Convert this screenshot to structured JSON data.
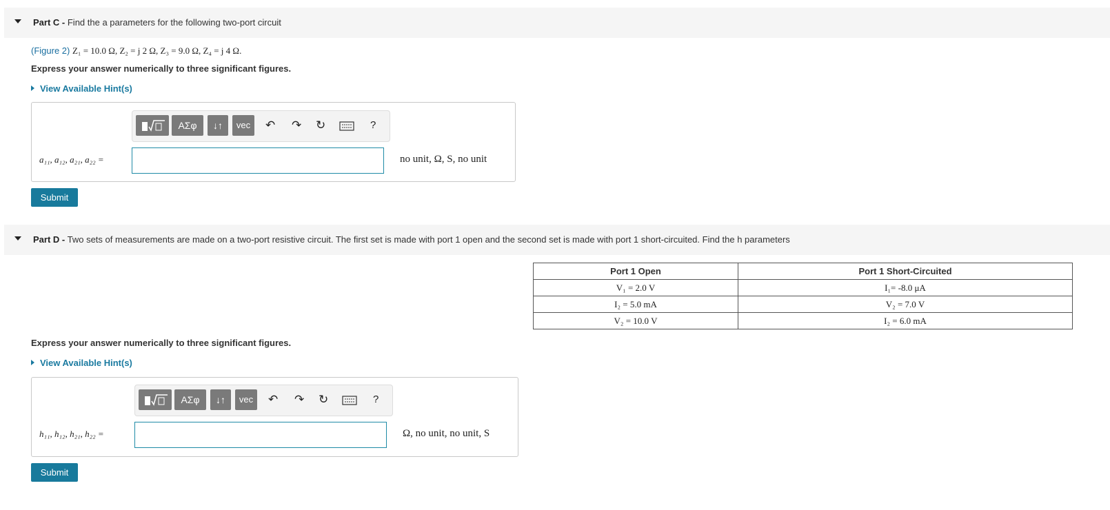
{
  "part_c": {
    "label": "Part C -",
    "title": "Find the a parameters for the following two-port circuit",
    "figure_link": "(Figure 2)",
    "givens": "Z₁ = 10.0 Ω, Z₂ = j 2 Ω, Z₃ = 9.0 Ω, Z₄ = j 4 Ω.",
    "instruction": "Express your answer numerically to three significant figures.",
    "hint": "View Available Hint(s)",
    "var_label": "a₁₁, a₁₂, a₂₁, a₂₂ =",
    "units": "no unit, Ω, S, no unit",
    "answer_value": "",
    "submit": "Submit"
  },
  "part_d": {
    "label": "Part D -",
    "title": "Two sets of measurements are made on a two-port resistive circuit.  The first set is made with port 1 open and the second set is made with port 1 short-circuited. Find the h parameters",
    "table": {
      "headers": [
        "Port 1 Open",
        "Port 1 Short-Circuited"
      ],
      "rows": [
        [
          "V₁ = 2.0  V",
          "I₁= -8.0 μA"
        ],
        [
          "I₂ = 5.0  mA",
          "V₂ = 7.0  V"
        ],
        [
          "V₂ = 10.0  V",
          "I₂ = 6.0  mA"
        ]
      ]
    },
    "instruction": "Express your answer numerically to three significant figures.",
    "hint": "View Available Hint(s)",
    "var_label": "h₁₁, h₁₂, h₂₁, h₂₂ =",
    "units": "Ω, no unit, no unit, S",
    "answer_value": "",
    "submit": "Submit"
  },
  "toolbar": {
    "template_icon": "fraction-root-template-icon",
    "greek_label": "ΑΣφ",
    "arrows_label": "↓↑",
    "vec_label": "vec",
    "undo_icon": "undo-icon",
    "redo_icon": "redo-icon",
    "reset_icon": "reset-icon",
    "keyboard_icon": "keyboard-icon",
    "help_label": "?"
  }
}
